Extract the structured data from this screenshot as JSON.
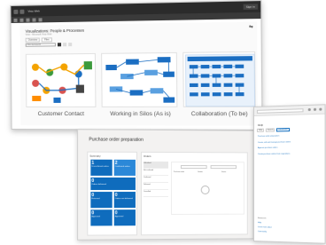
{
  "visio": {
    "titlebar": {
      "title": "Visio Web",
      "account": "Sign in"
    },
    "document_title": "Visualizations: People & Processes",
    "subtitle": "Visio - Microsoft Visio Web",
    "tabs": [
      "Overview",
      "Files"
    ],
    "filter_placeholder": "Filter by keyword",
    "diagrams": [
      {
        "caption": "Customer Contact"
      },
      {
        "caption": "Working in Silos (As is)"
      },
      {
        "caption": "Collaboration (To be)"
      }
    ],
    "colors": {
      "accent": "#1b6ec2",
      "orange": "#f4a300",
      "green": "#3c9a3c",
      "red": "#d9534f"
    }
  },
  "purchase": {
    "title": "Purchase order preparation",
    "summary_header": "Summary",
    "lists_header": "Orders",
    "tiles": [
      {
        "num": "1",
        "label": "Unconfirmed orders"
      },
      {
        "num": "2",
        "label": "Confirmed orders"
      },
      {
        "num": "0",
        "label": "Orders delivered"
      },
      {
        "num": "0",
        "label": "Returned"
      },
      {
        "num": "0",
        "label": "Orders not delivered"
      },
      {
        "num": "0",
        "label": "Approved"
      },
      {
        "num": "0",
        "label": "Approved"
      }
    ],
    "list_items": [
      "Unfinished",
      "Not confirmed",
      "Confirmed",
      "Delivered",
      "Cancelled"
    ],
    "table_headers": [
      "Purchase order",
      "Vendor",
      "Status"
    ]
  },
  "browser": {
    "panel_title": "Help",
    "tabs": [
      "Help",
      "Search",
      "Documents"
    ],
    "links": [
      "Purchase order preparation",
      "Create, edit and manage purchase orders",
      "Approve purchase orders",
      "Create purchase orders from requisitions"
    ],
    "footer": [
      "Resources",
      "Help",
      "Learn more about",
      "Community"
    ]
  }
}
